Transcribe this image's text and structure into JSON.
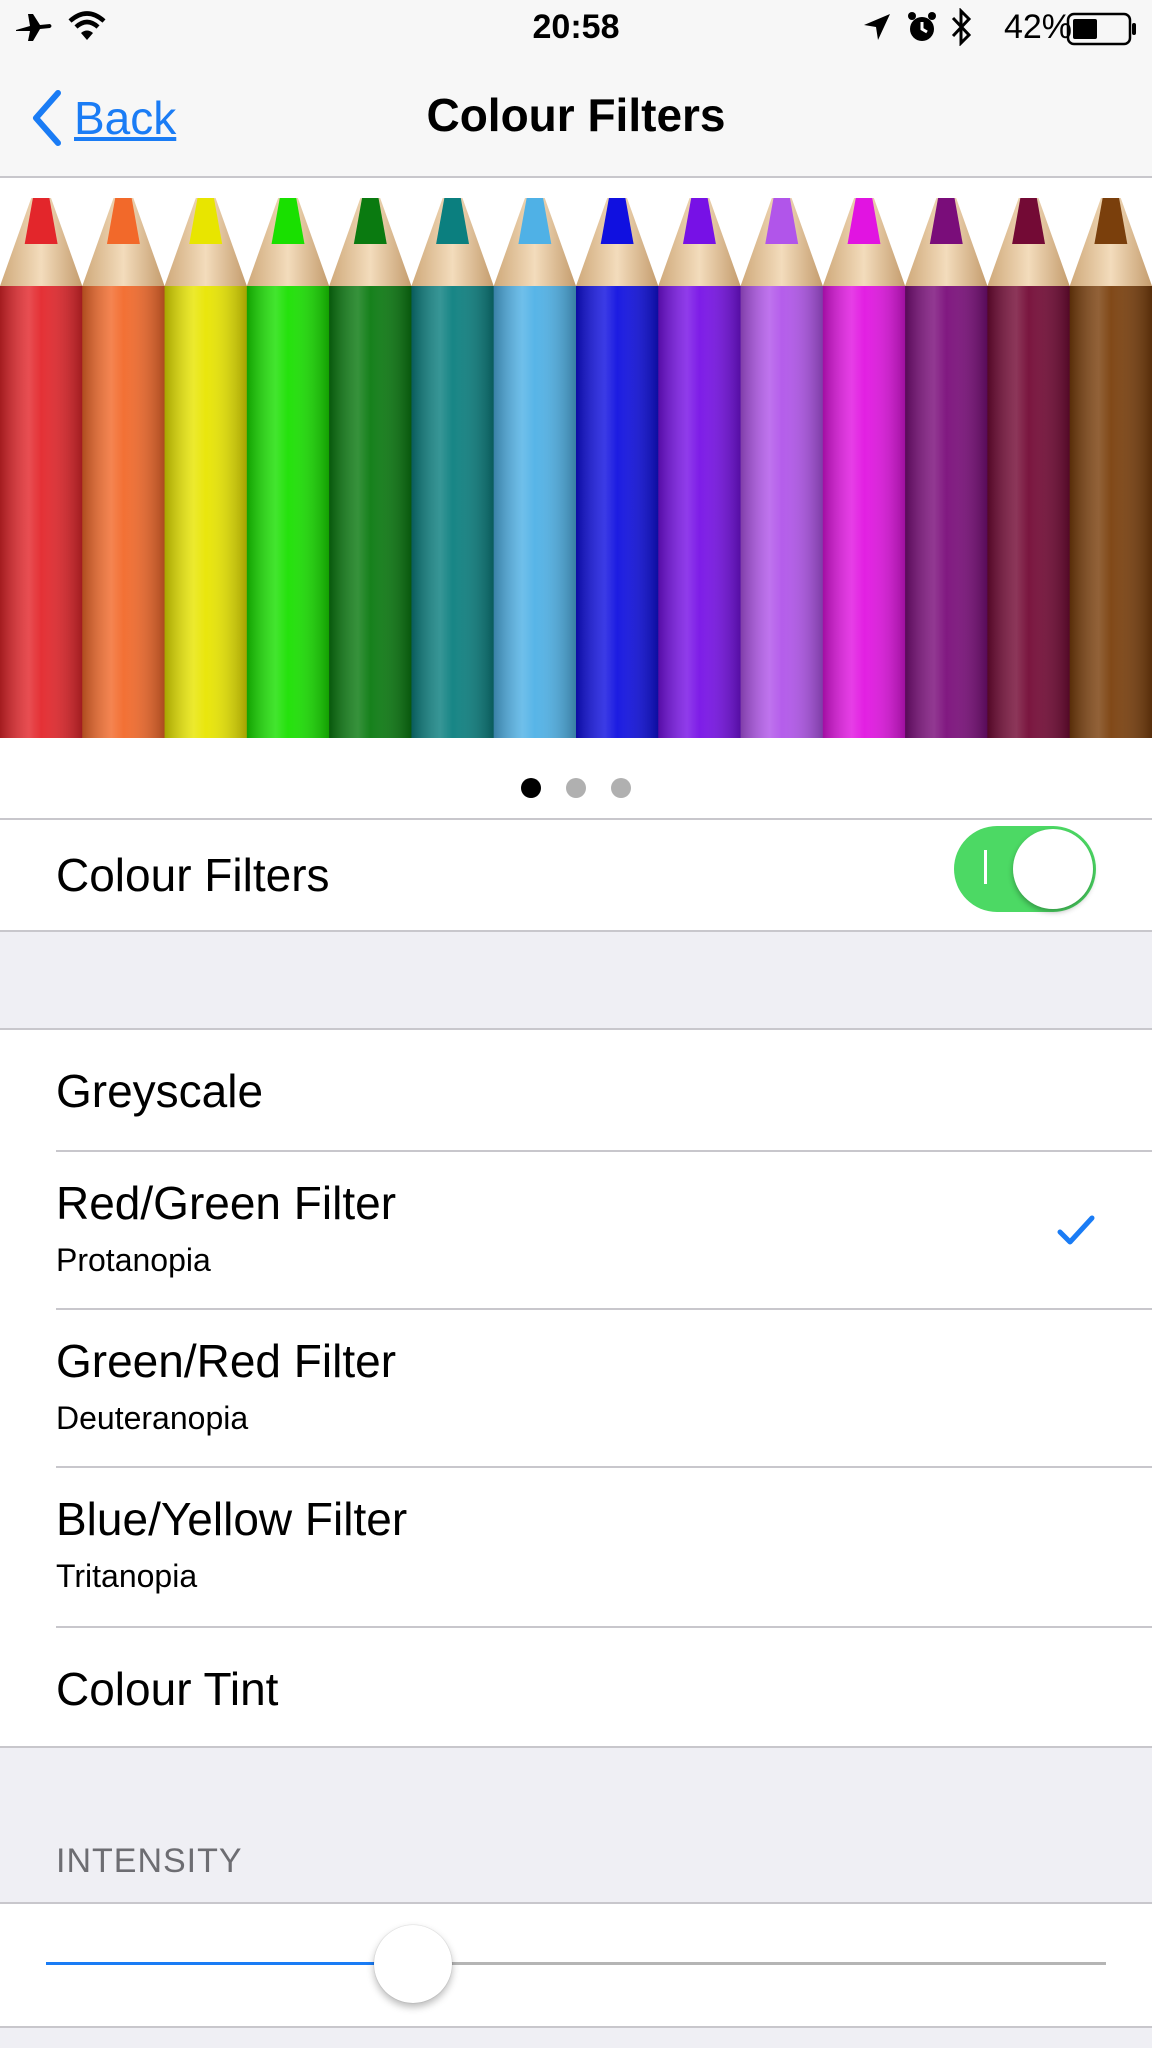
{
  "status_bar": {
    "time": "20:58",
    "battery": "42%",
    "icons": [
      "airplane-icon",
      "wifi-icon",
      "location-arrow-icon",
      "alarm-icon",
      "bluetooth-icon",
      "battery-icon"
    ]
  },
  "nav": {
    "back_label": "Back",
    "title": "Colour Filters"
  },
  "preview": {
    "pencil_colors": [
      "#e3262b",
      "#f2692a",
      "#e8e500",
      "#19e000",
      "#0a7a10",
      "#0b7f7f",
      "#4fb1e6",
      "#1010e0",
      "#7711e6",
      "#b155ea",
      "#e114e1",
      "#7a0d7a",
      "#730a35",
      "#7a3f0c"
    ],
    "page_count": 3,
    "current_page": 1
  },
  "filters_toggle": {
    "label": "Colour Filters",
    "on": true
  },
  "filters": [
    {
      "title": "Greyscale",
      "subtitle": "",
      "selected": false
    },
    {
      "title": "Red/Green Filter",
      "subtitle": "Protanopia",
      "selected": true
    },
    {
      "title": "Green/Red Filter",
      "subtitle": "Deuteranopia",
      "selected": false
    },
    {
      "title": "Blue/Yellow Filter",
      "subtitle": "Tritanopia",
      "selected": false
    },
    {
      "title": "Colour Tint",
      "subtitle": "",
      "selected": false
    }
  ],
  "intensity": {
    "header": "INTENSITY",
    "value": 0.33
  },
  "colors": {
    "accent": "#1a7cf5",
    "toggle_on": "#4cd964"
  }
}
